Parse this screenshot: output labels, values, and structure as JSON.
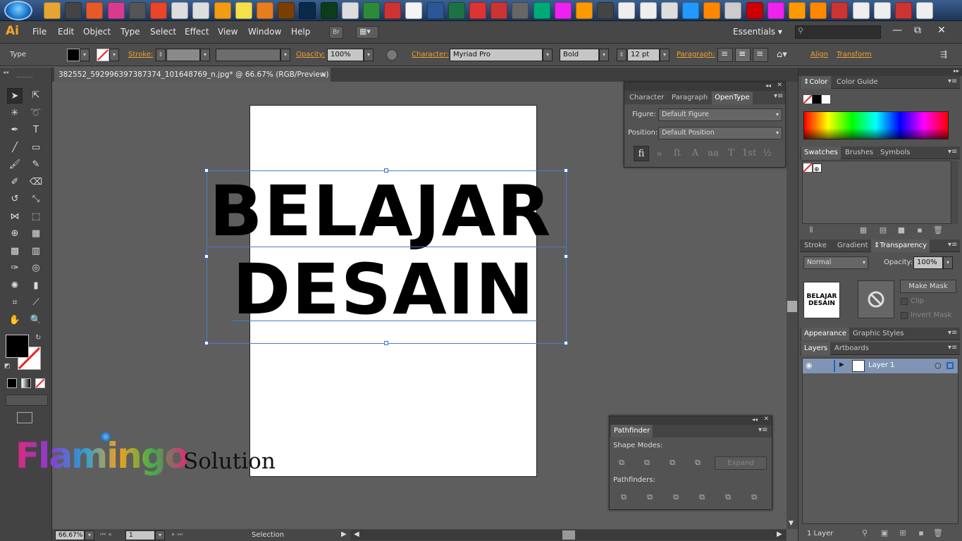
{
  "taskbar": {
    "apps": [
      "explorer",
      "steam",
      "firefox",
      "itunes",
      "media",
      "chrome",
      "notes",
      "files",
      "vlc",
      "photos",
      "blender",
      "illustrator",
      "photoshop",
      "dreamweaver",
      "calendar",
      "xsheet",
      "acrobat",
      "notepad",
      "word",
      "excel",
      "pdf",
      "app",
      "app",
      "app",
      "app",
      "app",
      "app",
      "app",
      "app",
      "app",
      "app",
      "app",
      "app",
      "app",
      "app",
      "app",
      "app",
      "app",
      "app",
      "app",
      "app",
      "app"
    ]
  },
  "menubar": {
    "logo": "Ai",
    "items": [
      "File",
      "Edit",
      "Object",
      "Type",
      "Select",
      "Effect",
      "View",
      "Window",
      "Help"
    ],
    "br": "Br",
    "workspace": "Essentials",
    "min": "—",
    "max": "⧉",
    "close": "✕"
  },
  "control": {
    "type_label": "Type",
    "stroke_label": "Stroke:",
    "opacity_label": "Opacity:",
    "opacity_value": "100%",
    "character_label": "Character:",
    "font": "Myriad Pro",
    "style": "Bold",
    "size": "12 pt",
    "paragraph_label": "Paragraph:",
    "align_label": "Align",
    "transform_label": "Transform"
  },
  "document": {
    "tab_title": "382552_592996397387374_101648769_n.jpg* @ 66.67% (RGB/Preview)",
    "tab_close": "×",
    "line1": "BELAJAR",
    "line2": "DESAIN"
  },
  "watermark": {
    "logo": "Flamingo",
    "text": "Solution"
  },
  "status": {
    "zoom": "66.67%",
    "page": "1",
    "tool": "Selection"
  },
  "opentype": {
    "tabs": [
      "Character",
      "Paragraph",
      "OpenType"
    ],
    "figure_label": "Figure:",
    "figure_value": "Default Figure",
    "position_label": "Position:",
    "position_value": "Default Position",
    "glyphs": [
      "fi",
      "ℴ",
      "ſt",
      "A",
      "aa",
      "T",
      "1st",
      "½"
    ]
  },
  "pathfinder": {
    "title": "Pathfinder",
    "shape_modes": "Shape Modes:",
    "expand": "Expand",
    "pathfinders": "Pathfinders:"
  },
  "right": {
    "color_tabs": [
      "Color",
      "Color Guide"
    ],
    "swatch_tabs": [
      "Swatches",
      "Brushes",
      "Symbols"
    ],
    "trans_tabs": [
      "Stroke",
      "Gradient",
      "Transparency"
    ],
    "blend": "Normal",
    "opacity_label": "Opacity:",
    "opacity_value": "100%",
    "thumb_line1": "BELAJAR",
    "thumb_line2": "DESAIN",
    "make_mask": "Make Mask",
    "clip": "Clip",
    "invert": "Invert Mask",
    "appearance_tabs": [
      "Appearance",
      "Graphic Styles"
    ],
    "layers_tabs": [
      "Layers",
      "Artboards"
    ],
    "layer_name": "Layer 1",
    "layer_count": "1 Layer"
  }
}
